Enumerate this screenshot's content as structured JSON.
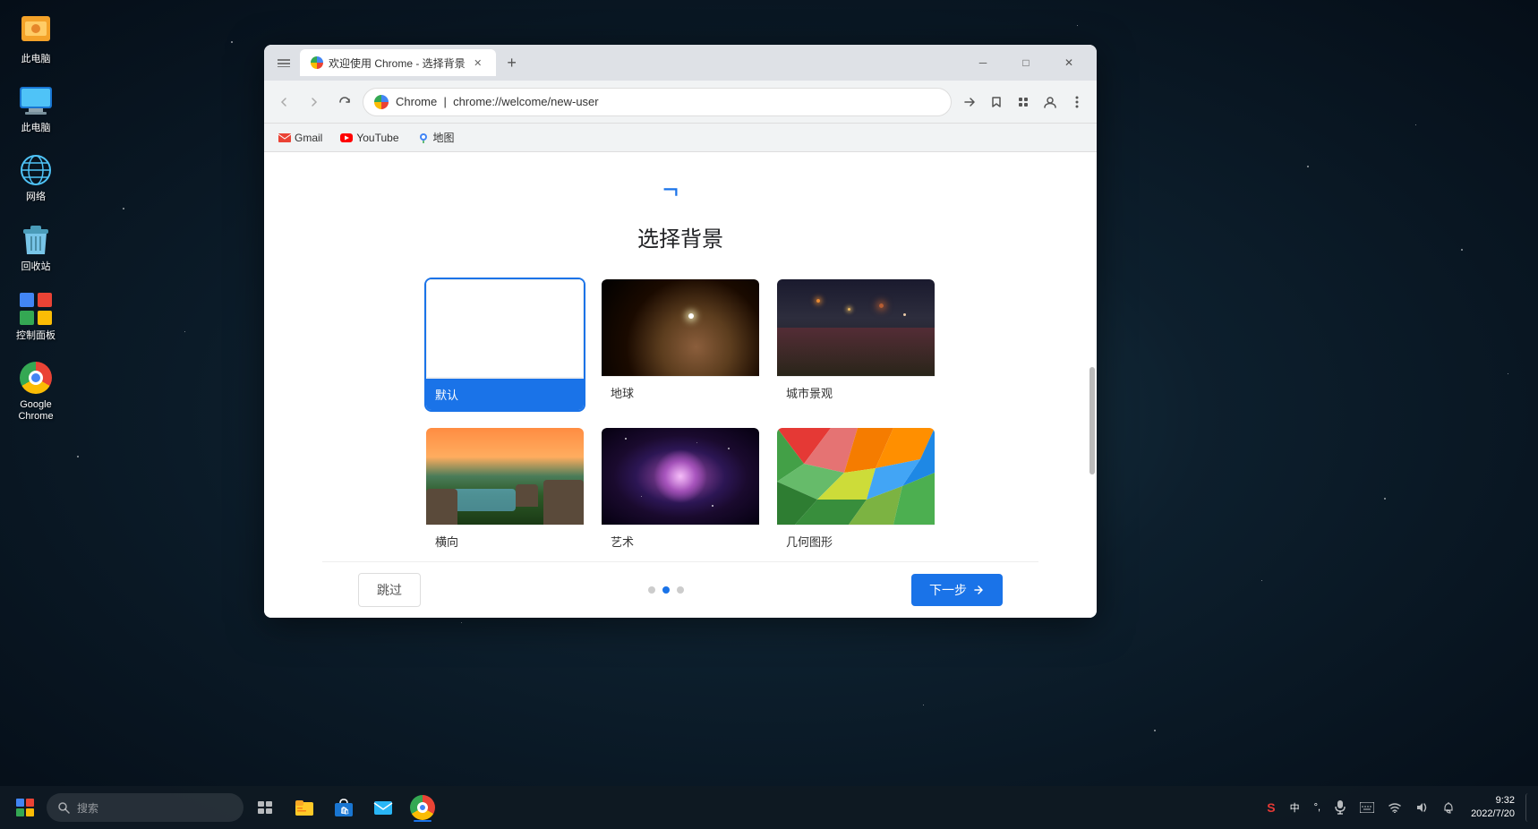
{
  "desktop": {
    "icons": [
      {
        "id": "my-computer",
        "label": "此电脑",
        "emoji": "💻"
      },
      {
        "id": "network",
        "label": "网络",
        "emoji": "🌐"
      },
      {
        "id": "recycle-bin",
        "label": "回收站",
        "emoji": "🗑️"
      },
      {
        "id": "control-panel",
        "label": "控制面板",
        "emoji": "🖥️"
      },
      {
        "id": "google-chrome",
        "label": "Google\nChrome",
        "emoji": "chrome"
      }
    ]
  },
  "chrome_window": {
    "tab_title": "欢迎使用 Chrome - 选择背景",
    "url": "chrome://welcome/new-user",
    "bookmarks": [
      {
        "label": "Gmail",
        "type": "gmail"
      },
      {
        "label": "YouTube",
        "type": "youtube"
      },
      {
        "label": "地图",
        "type": "maps"
      }
    ]
  },
  "page": {
    "title": "选择背景",
    "backgrounds": [
      {
        "id": "default",
        "label": "默认",
        "selected": true,
        "type": "default"
      },
      {
        "id": "earth",
        "label": "地球",
        "selected": false,
        "type": "earth"
      },
      {
        "id": "city",
        "label": "城市景观",
        "selected": false,
        "type": "city"
      },
      {
        "id": "landscape",
        "label": "横向",
        "selected": false,
        "type": "landscape"
      },
      {
        "id": "art",
        "label": "艺术",
        "selected": false,
        "type": "galaxy"
      },
      {
        "id": "geometric",
        "label": "几何图形",
        "selected": false,
        "type": "geometric"
      }
    ],
    "skip_label": "跳过",
    "next_label": "下一步",
    "dots": [
      {
        "active": false
      },
      {
        "active": true
      },
      {
        "active": false
      }
    ]
  },
  "taskbar": {
    "search_placeholder": "搜索",
    "apps": [
      {
        "id": "file-explorer",
        "emoji": "📁"
      },
      {
        "id": "store",
        "emoji": "🛍️"
      },
      {
        "id": "mail",
        "emoji": "✉️"
      },
      {
        "id": "chrome",
        "type": "chrome",
        "active": true
      }
    ],
    "clock": {
      "time": "9:32",
      "date": "2022/7/20"
    }
  }
}
